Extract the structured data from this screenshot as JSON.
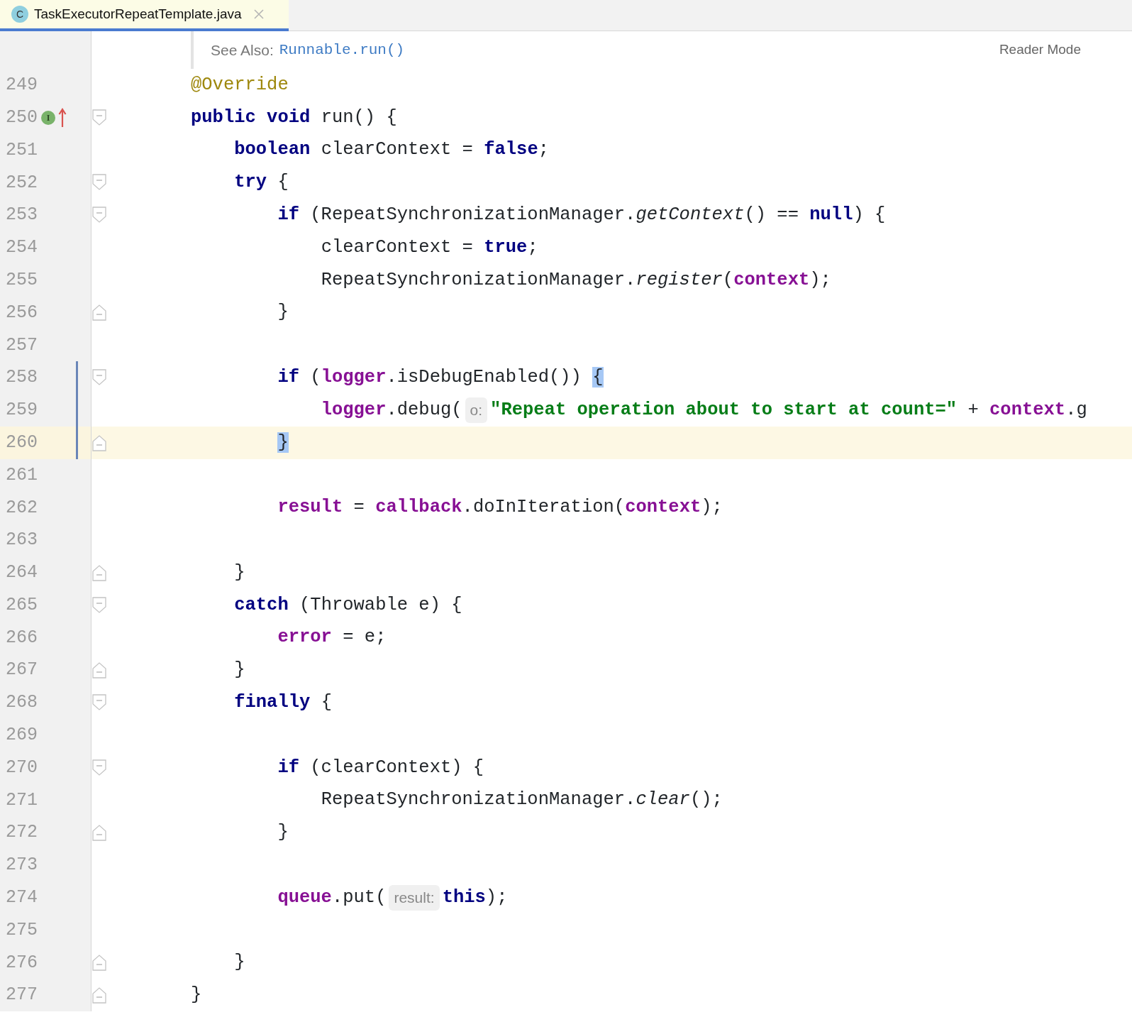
{
  "tab": {
    "icon_letter": "C",
    "title": "TaskExecutorRepeatTemplate.java",
    "selected": true
  },
  "doc": {
    "label": "See Also:",
    "link": "Runnable.run()"
  },
  "reader_mode": "Reader Mode",
  "lines": [
    {
      "number": "249",
      "tokens": [
        {
          "kind": "annotation",
          "text": "@Override"
        }
      ]
    },
    {
      "number": "250",
      "fold_start": true,
      "markers": [
        {
          "kind": "implements",
          "letter": "I"
        },
        {
          "kind": "overrides"
        }
      ],
      "tokens": [
        {
          "kind": "keyword",
          "text": "public void"
        },
        {
          "kind": "plain",
          "text": " run() {"
        }
      ],
      "children": [
        {
          "number": "251",
          "tokens": [
            {
              "kind": "keyword",
              "text": "boolean"
            },
            {
              "kind": "plain",
              "text": " clearContext = "
            },
            {
              "kind": "keyword",
              "text": "false"
            },
            {
              "kind": "plain",
              "text": ";"
            }
          ]
        },
        {
          "number": "252",
          "fold_start": true,
          "tokens": [
            {
              "kind": "keyword",
              "text": "try"
            },
            {
              "kind": "plain",
              "text": " {"
            }
          ],
          "children": [
            {
              "number": "253",
              "fold_start": true,
              "tokens": [
                {
                  "kind": "keyword",
                  "text": "if"
                },
                {
                  "kind": "plain",
                  "text": " (RepeatSynchronizationManager."
                },
                {
                  "kind": "static",
                  "text": "getContext"
                },
                {
                  "kind": "plain",
                  "text": "() == "
                },
                {
                  "kind": "keyword",
                  "text": "null"
                },
                {
                  "kind": "plain",
                  "text": ") {"
                }
              ],
              "children": [
                {
                  "number": "254",
                  "tokens": [
                    {
                      "kind": "plain",
                      "text": "clearContext = "
                    },
                    {
                      "kind": "keyword",
                      "text": "true"
                    },
                    {
                      "kind": "plain",
                      "text": ";"
                    }
                  ]
                },
                {
                  "number": "255",
                  "tokens": [
                    {
                      "kind": "plain",
                      "text": "RepeatSynchronizationManager."
                    },
                    {
                      "kind": "static",
                      "text": "register"
                    },
                    {
                      "kind": "plain",
                      "text": "("
                    },
                    {
                      "kind": "field",
                      "text": "context"
                    },
                    {
                      "kind": "plain",
                      "text": ");"
                    }
                  ]
                }
              ]
            },
            {
              "number": "256",
              "fold_end": true,
              "tokens": [
                {
                  "kind": "plain",
                  "text": "}"
                }
              ]
            },
            {
              "number": "257"
            },
            {
              "number": "258",
              "fold_start": true,
              "changed": true,
              "tokens": [
                {
                  "kind": "keyword",
                  "text": "if"
                },
                {
                  "kind": "plain",
                  "text": " ("
                },
                {
                  "kind": "field",
                  "text": "logger"
                },
                {
                  "kind": "plain",
                  "text": ".isDebugEnabled()) "
                },
                {
                  "kind": "plain",
                  "text": "{",
                  "matched": true
                }
              ],
              "children": [
                {
                  "number": "259",
                  "changed": true,
                  "tokens": [
                    {
                      "kind": "field",
                      "text": "logger"
                    },
                    {
                      "kind": "plain",
                      "text": ".debug("
                    },
                    {
                      "kind": "hint",
                      "text": "o:"
                    },
                    {
                      "kind": "string",
                      "text": "\"Repeat operation about to start at count=\""
                    },
                    {
                      "kind": "plain",
                      "text": " + "
                    },
                    {
                      "kind": "field",
                      "text": "context"
                    },
                    {
                      "kind": "plain",
                      "text": ".g"
                    }
                  ]
                }
              ]
            },
            {
              "number": "260",
              "fold_end": true,
              "changed": true,
              "current": true,
              "tokens": [
                {
                  "kind": "plain",
                  "text": "}",
                  "matched": true
                }
              ]
            },
            {
              "number": "261"
            },
            {
              "number": "262",
              "tokens": [
                {
                  "kind": "field",
                  "text": "result"
                },
                {
                  "kind": "plain",
                  "text": " = "
                },
                {
                  "kind": "field",
                  "text": "callback"
                },
                {
                  "kind": "plain",
                  "text": ".doInIteration("
                },
                {
                  "kind": "field",
                  "text": "context"
                },
                {
                  "kind": "plain",
                  "text": ");"
                }
              ]
            },
            {
              "number": "263"
            }
          ]
        },
        {
          "number": "264",
          "fold_end": true,
          "tokens": [
            {
              "kind": "plain",
              "text": "}"
            }
          ]
        },
        {
          "number": "265",
          "fold_start": true,
          "tokens": [
            {
              "kind": "keyword",
              "text": "catch"
            },
            {
              "kind": "plain",
              "text": " (Throwable e) {"
            }
          ],
          "children": [
            {
              "number": "266",
              "tokens": [
                {
                  "kind": "field",
                  "text": "error"
                },
                {
                  "kind": "plain",
                  "text": " = e;"
                }
              ]
            }
          ]
        },
        {
          "number": "267",
          "fold_end": true,
          "tokens": [
            {
              "kind": "plain",
              "text": "}"
            }
          ]
        },
        {
          "number": "268",
          "fold_start": true,
          "tokens": [
            {
              "kind": "keyword",
              "text": "finally"
            },
            {
              "kind": "plain",
              "text": " {"
            }
          ],
          "children": [
            {
              "number": "269"
            },
            {
              "number": "270",
              "fold_start": true,
              "tokens": [
                {
                  "kind": "keyword",
                  "text": "if"
                },
                {
                  "kind": "plain",
                  "text": " (clearContext) {"
                }
              ],
              "children": [
                {
                  "number": "271",
                  "tokens": [
                    {
                      "kind": "plain",
                      "text": "RepeatSynchronizationManager."
                    },
                    {
                      "kind": "static",
                      "text": "clear"
                    },
                    {
                      "kind": "plain",
                      "text": "();"
                    }
                  ]
                }
              ]
            },
            {
              "number": "272",
              "fold_end": true,
              "tokens": [
                {
                  "kind": "plain",
                  "text": "}"
                }
              ]
            },
            {
              "number": "273"
            },
            {
              "number": "274",
              "tokens": [
                {
                  "kind": "field",
                  "text": "queue"
                },
                {
                  "kind": "plain",
                  "text": ".put("
                },
                {
                  "kind": "hint",
                  "text": "result:"
                },
                {
                  "kind": "keyword",
                  "text": "this"
                },
                {
                  "kind": "plain",
                  "text": ");"
                }
              ]
            },
            {
              "number": "275"
            }
          ]
        },
        {
          "number": "276",
          "fold_end": true,
          "tokens": [
            {
              "kind": "plain",
              "text": "}"
            }
          ]
        }
      ]
    },
    {
      "number": "277",
      "fold_end": true,
      "tokens": [
        {
          "kind": "plain",
          "text": "}"
        }
      ]
    }
  ]
}
